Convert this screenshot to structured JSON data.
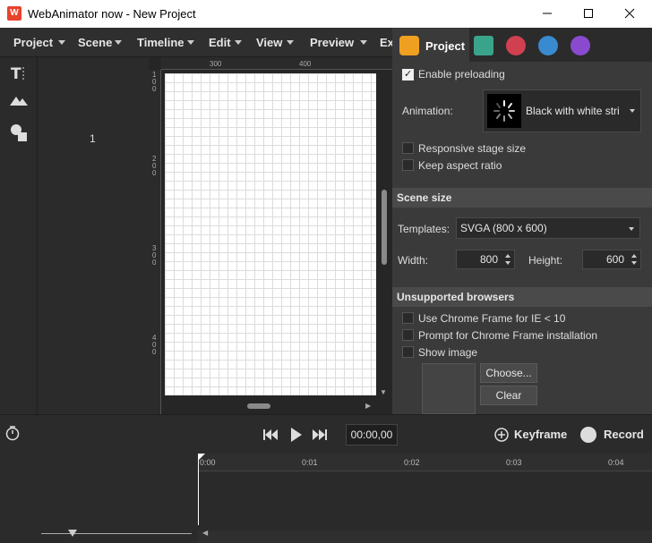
{
  "window": {
    "title": "WebAnimator now - New Project"
  },
  "menu": {
    "items": [
      {
        "label": "Project"
      },
      {
        "label": "Scene"
      },
      {
        "label": "Timeline"
      },
      {
        "label": "Edit"
      },
      {
        "label": "View"
      },
      {
        "label": "Preview"
      },
      {
        "label": "Ex"
      }
    ]
  },
  "scenes": {
    "current_number": "1"
  },
  "rulers": {
    "top_ticks": [
      "300",
      "400"
    ],
    "left_ticks": [
      "100",
      "200",
      "300",
      "400"
    ]
  },
  "panel": {
    "active_tab": "Project",
    "tabs": [
      "html5-icon",
      "film-icon",
      "move-icon",
      "magic-wand-icon",
      "sparkle-icon"
    ],
    "enable_preloading": {
      "label": "Enable preloading",
      "checked": true
    },
    "animation": {
      "label": "Animation:",
      "value": "Black with white stri"
    },
    "responsive": {
      "label": "Responsive stage size",
      "checked": false
    },
    "keep_aspect": {
      "label": "Keep aspect ratio",
      "checked": false
    },
    "scene_size": {
      "header": "Scene size",
      "templates_label": "Templates:",
      "templates_value": "SVGA (800 x 600)",
      "width_label": "Width:",
      "width_value": "800",
      "height_label": "Height:",
      "height_value": "600"
    },
    "unsupported": {
      "header": "Unsupported browsers",
      "chrome_frame": {
        "label": "Use Chrome Frame for IE < 10",
        "checked": false
      },
      "prompt": {
        "label": "Prompt for Chrome Frame installation",
        "checked": false
      },
      "show_image": {
        "label": "Show image",
        "checked": false
      },
      "choose_label": "Choose...",
      "clear_label": "Clear"
    }
  },
  "transport": {
    "timecode": "00:00,00",
    "keyframe_label": "Keyframe",
    "record_label": "Record"
  },
  "timeline": {
    "ticks": [
      "0:00",
      "0:01",
      "0:02",
      "0:03",
      "0:04"
    ]
  },
  "colors": {
    "accent": "#e8432c",
    "background": "#2b2b2b",
    "panel": "#3a3a3a"
  }
}
